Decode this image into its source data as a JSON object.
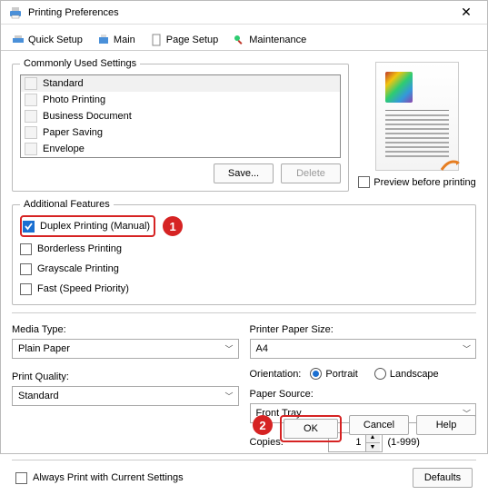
{
  "window": {
    "title": "Printing Preferences"
  },
  "tabs": {
    "quick_setup": "Quick Setup",
    "main": "Main",
    "page_setup": "Page Setup",
    "maintenance": "Maintenance"
  },
  "commonly_used": {
    "legend": "Commonly Used Settings",
    "items": [
      "Standard",
      "Photo Printing",
      "Business Document",
      "Paper Saving",
      "Envelope"
    ],
    "save_label": "Save...",
    "delete_label": "Delete"
  },
  "preview_checkbox": "Preview before printing",
  "additional_features": {
    "legend": "Additional Features",
    "items": [
      {
        "label": "Duplex Printing (Manual)",
        "checked": true
      },
      {
        "label": "Borderless Printing",
        "checked": false
      },
      {
        "label": "Grayscale Printing",
        "checked": false
      },
      {
        "label": "Fast (Speed Priority)",
        "checked": false
      }
    ]
  },
  "callouts": {
    "one": "1",
    "two": "2"
  },
  "media_type": {
    "label": "Media Type:",
    "value": "Plain Paper"
  },
  "print_quality": {
    "label": "Print Quality:",
    "value": "Standard"
  },
  "paper_size": {
    "label": "Printer Paper Size:",
    "value": "A4"
  },
  "orientation": {
    "label": "Orientation:",
    "portrait": "Portrait",
    "landscape": "Landscape"
  },
  "paper_source": {
    "label": "Paper Source:",
    "value": "Front Tray"
  },
  "copies": {
    "label": "Copies:",
    "value": "1",
    "range": "(1-999)"
  },
  "always_print": "Always Print with Current Settings",
  "defaults": "Defaults",
  "footer": {
    "ok": "OK",
    "cancel": "Cancel",
    "help": "Help"
  }
}
